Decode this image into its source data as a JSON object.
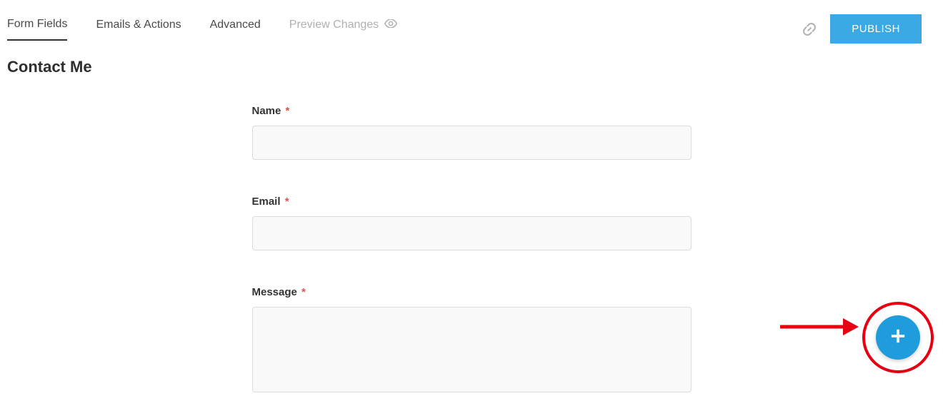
{
  "tabs": {
    "form_fields": "Form Fields",
    "emails_actions": "Emails & Actions",
    "advanced": "Advanced",
    "preview": "Preview Changes"
  },
  "header": {
    "publish": "PUBLISH"
  },
  "page_title": "Contact Me",
  "fields": {
    "name": {
      "label": "Name",
      "required": "*"
    },
    "email": {
      "label": "Email",
      "required": "*"
    },
    "message": {
      "label": "Message",
      "required": "*"
    }
  }
}
